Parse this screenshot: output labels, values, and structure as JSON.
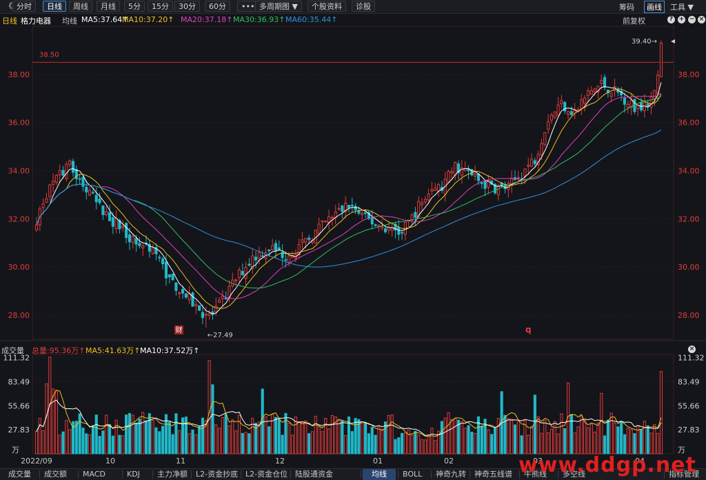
{
  "toolbar": {
    "back_glyph": "《",
    "periods": [
      "分时",
      "日线",
      "周线",
      "月线",
      "5分",
      "15分",
      "30分",
      "60分",
      "•••",
      "多周期图 ▼",
      "个股资料",
      "诊股"
    ],
    "active_period": "日线",
    "right": [
      "筹码",
      "画线",
      "工具 ▼"
    ],
    "right_active": "画线"
  },
  "ma_header": {
    "period": "日线",
    "stock_name": "格力电器",
    "ma_type": "均线",
    "items": [
      {
        "text": "MA5:37.64↑",
        "color": "#ffffff"
      },
      {
        "text": "MA10:37.20↑",
        "color": "#f0c020"
      },
      {
        "text": "MA20:37.18↑",
        "color": "#e040c0"
      },
      {
        "text": "MA30:36.93↑",
        "color": "#30c060"
      },
      {
        "text": "MA60:35.44↑",
        "color": "#3090e0"
      }
    ],
    "adjust": "前复权",
    "icons": [
      "help-icon",
      "plus-icon",
      "minus-icon",
      "close-icon"
    ]
  },
  "price_pane": {
    "y_ticks": [
      "38.00",
      "36.00",
      "34.00",
      "32.00",
      "30.00",
      "28.00"
    ],
    "y_values": [
      38,
      36,
      34,
      32,
      30,
      28
    ],
    "ref_line_value": 38.5,
    "ref_line_label": "38.50",
    "high_label": "39.40→",
    "low_label": "←27.49",
    "marker_cai": "财",
    "marker_q": "q",
    "up_color": "#e03c3c",
    "down_color": "#20b8c8"
  },
  "volume_header": {
    "title": "成交量",
    "items": [
      {
        "text": "总量:95.36万↑",
        "color": "#e03c3c"
      },
      {
        "text": "MA5:41.63万↑",
        "color": "#f0c020"
      },
      {
        "text": "MA10:37.52万↑",
        "color": "#ffffff"
      }
    ]
  },
  "volume_pane": {
    "y_ticks": [
      "111.32",
      "83.49",
      "55.66",
      "27.83",
      "万"
    ],
    "y_values": [
      111.32,
      83.49,
      55.66,
      27.83
    ]
  },
  "x_axis": {
    "labels": [
      "2022/09",
      "10",
      "11",
      "12",
      "01",
      "02",
      "03",
      "04"
    ]
  },
  "bottom_tabs": [
    "成交量",
    "成交额",
    "MACD",
    "KDJ",
    "主力净额",
    "L2-资金抄底",
    "L2-资金仓位",
    "陆股通资金",
    "均线",
    "BOLL",
    "神奇九转",
    "神奇五线谱",
    "牛熊线",
    "多空线",
    "指标管理"
  ],
  "bottom_tab_active": "均线",
  "watermark": "www.ddgp.net",
  "chart_data": {
    "type": "candlestick",
    "title": "格力电器",
    "price_range": [
      27,
      40
    ],
    "volume_range": [
      0,
      115
    ],
    "x_labels": [
      "2022/09",
      "10",
      "11",
      "12",
      "01",
      "02",
      "03",
      "04"
    ],
    "close_anchors": [
      [
        0,
        32.0
      ],
      [
        5,
        33.5
      ],
      [
        10,
        34.2
      ],
      [
        15,
        33.2
      ],
      [
        20,
        32.3
      ],
      [
        25,
        31.7
      ],
      [
        30,
        31.0
      ],
      [
        35,
        30.8
      ],
      [
        40,
        29.5
      ],
      [
        45,
        28.8
      ],
      [
        50,
        28.1
      ],
      [
        53,
        28.0
      ],
      [
        56,
        28.6
      ],
      [
        60,
        29.5
      ],
      [
        65,
        30.4
      ],
      [
        70,
        30.8
      ],
      [
        75,
        30.5
      ],
      [
        80,
        30.9
      ],
      [
        85,
        31.6
      ],
      [
        90,
        32.2
      ],
      [
        94,
        32.6
      ],
      [
        98,
        32.1
      ],
      [
        102,
        31.8
      ],
      [
        106,
        31.6
      ],
      [
        110,
        31.4
      ],
      [
        114,
        32.3
      ],
      [
        118,
        33.1
      ],
      [
        122,
        33.3
      ],
      [
        126,
        34.2
      ],
      [
        130,
        33.9
      ],
      [
        134,
        33.5
      ],
      [
        138,
        33.3
      ],
      [
        142,
        33.3
      ],
      [
        146,
        33.9
      ],
      [
        150,
        34.5
      ],
      [
        154,
        36.2
      ],
      [
        158,
        36.8
      ],
      [
        162,
        36.4
      ],
      [
        166,
        37.2
      ],
      [
        170,
        37.6
      ],
      [
        174,
        37.3
      ],
      [
        178,
        36.9
      ],
      [
        180,
        36.6
      ],
      [
        184,
        36.9
      ],
      [
        187,
        37.8
      ],
      [
        188,
        39.3
      ]
    ],
    "n_bars": 189,
    "last_bar": {
      "open": 37.9,
      "close": 39.3,
      "high": 39.4,
      "low": 37.9
    },
    "series": [
      {
        "name": "MA5",
        "last": 37.64,
        "color": "#ffffff"
      },
      {
        "name": "MA10",
        "last": 37.2,
        "color": "#f0c020"
      },
      {
        "name": "MA20",
        "last": 37.18,
        "color": "#e040c0"
      },
      {
        "name": "MA30",
        "last": 36.93,
        "color": "#30c060"
      },
      {
        "name": "MA60",
        "last": 35.44,
        "color": "#3090e0"
      }
    ],
    "volume": {
      "last_total": 95.36,
      "ma5": 41.63,
      "ma10": 37.52
    }
  }
}
